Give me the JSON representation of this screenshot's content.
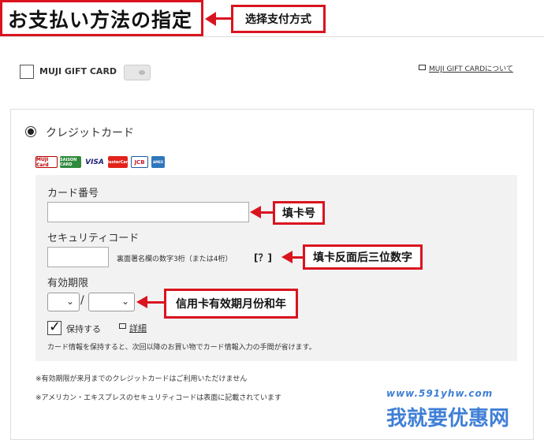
{
  "header": {
    "title": "お支払い方法の指定",
    "annotation": "选择支付方式"
  },
  "gift_card": {
    "label": "MUJI GIFT CARD",
    "link": "MUJI GIFT CARDについて"
  },
  "credit_card": {
    "option_label": "クレジットカード",
    "logos": [
      "MUJI Card",
      "SAISON CARD",
      "VISA",
      "MasterCard",
      "JCB",
      "AMEX"
    ],
    "card_number_label": "カード番号",
    "card_number_value": "",
    "card_number_annotation": "填卡号",
    "security_label": "セキュリティコード",
    "security_value": "",
    "security_hint": "裏面署名欄の数字3桁（または4桁）",
    "security_help": "[？]",
    "security_annotation": "填卡反面后三位数字",
    "expiry_label": "有効期限",
    "expiry_month": "",
    "expiry_year": "",
    "expiry_separator": "/",
    "expiry_annotation": "信用卡有效期月份和年",
    "save_label": "保持する",
    "details_link": "詳細",
    "save_note": "カード情報を保持すると、次回以降のお買い物でカード情報入力の手間が省けます。"
  },
  "notes": [
    "※有効期限が来月までのクレジットカードはご利用いただけません",
    "※アメリカン・エキスプレスのセキュリティコードは表面に記載されています"
  ],
  "watermark": {
    "url": "www.591yhw.com",
    "brand": "我就要优惠网"
  },
  "colors": {
    "annotation_red": "#d9141f",
    "panel_gray": "#f2f2f2",
    "watermark_blue": "#3f7fd6"
  }
}
